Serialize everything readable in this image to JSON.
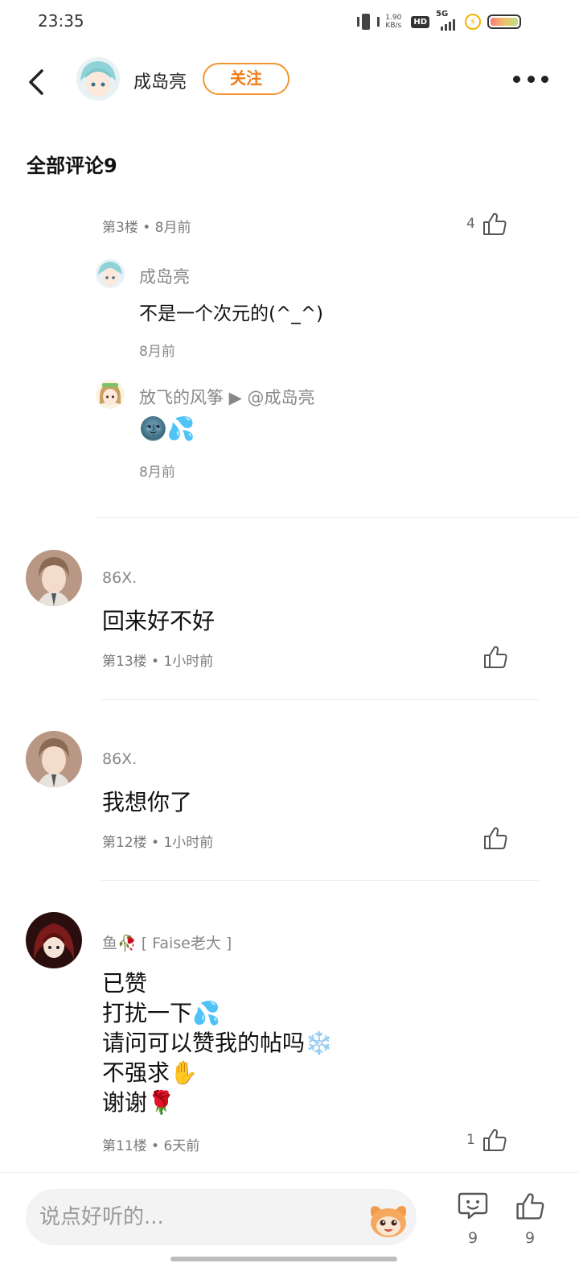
{
  "status_bar": {
    "time": "23:35",
    "net_speed": "1.90",
    "net_unit": "KB/s",
    "hd": "HD",
    "network": "5G"
  },
  "header": {
    "user_name": "成岛亮",
    "follow_label": "关注"
  },
  "section_title": "全部评论9",
  "reply_thread": {
    "floor_meta": "第3楼 • 8月前",
    "like_count": "4",
    "replies": [
      {
        "name": "成岛亮",
        "text": "不是一个次元的(^_^)",
        "time": "8月前"
      },
      {
        "name": "放飞的风筝 ▶ @成岛亮",
        "text": "🌚💦",
        "time": "8月前"
      }
    ]
  },
  "comments": [
    {
      "user": "86X.",
      "text": "回来好不好",
      "meta": "第13楼 • 1小时前",
      "likes": ""
    },
    {
      "user": "86X.",
      "text": "我想你了",
      "meta": "第12楼 • 1小时前",
      "likes": ""
    },
    {
      "user": "鱼🥀 [ Faise老大 ]",
      "text": "已赞\n打扰一下💦\n请问可以赞我的帖吗❄️\n不强求✋\n谢谢🌹",
      "meta": "第11楼 • 6天前",
      "likes": "1"
    }
  ],
  "bottom_bar": {
    "input_placeholder": "说点好听的...",
    "comment_count": "9",
    "like_count": "9"
  },
  "colors": {
    "accent": "#f27c14",
    "text_secondary": "#888888"
  }
}
